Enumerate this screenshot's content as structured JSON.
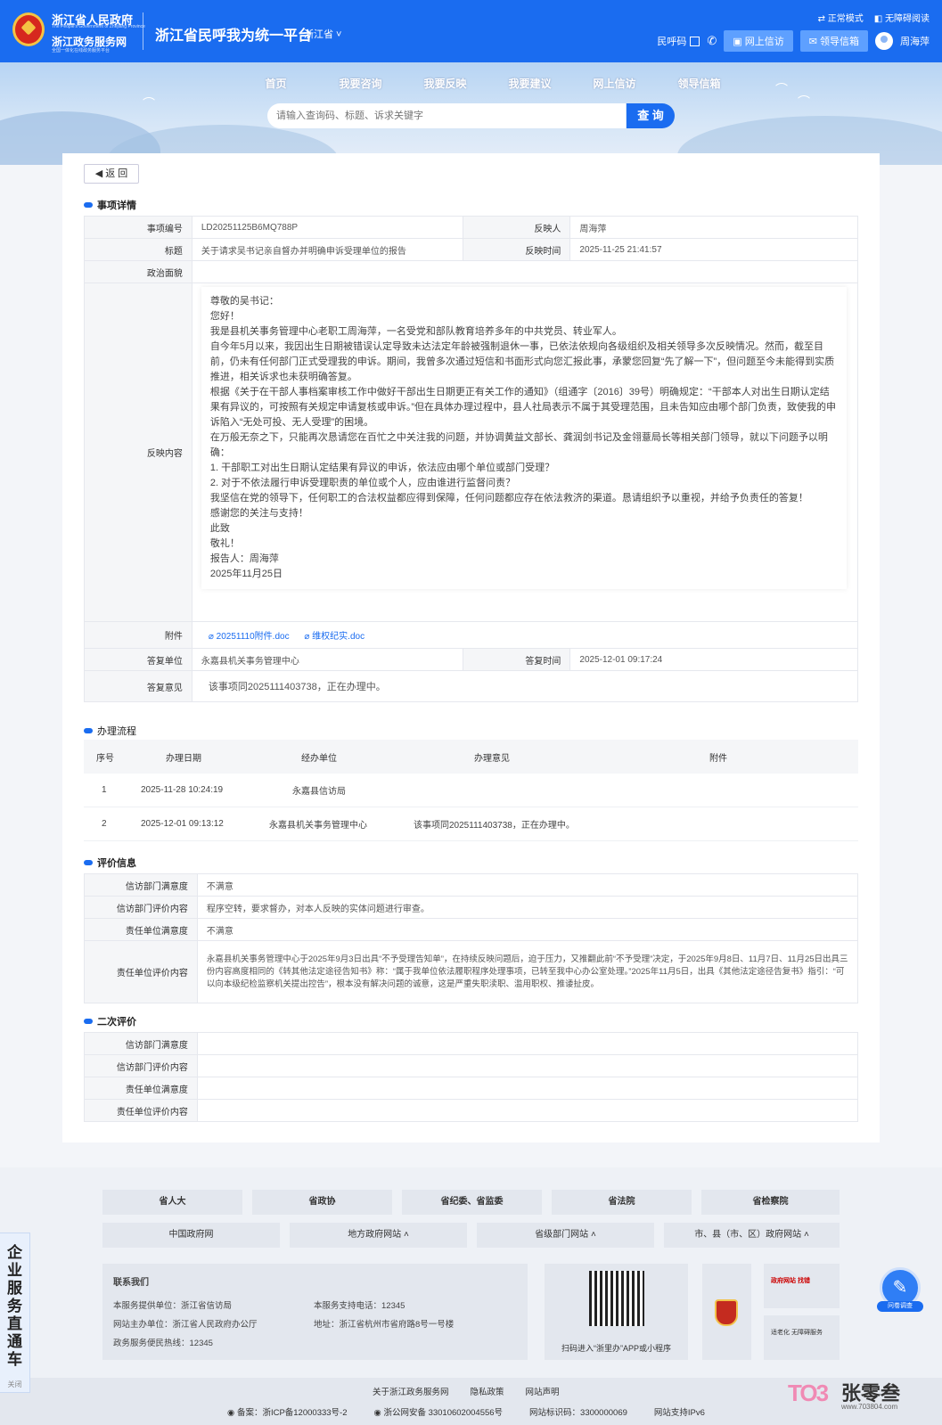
{
  "header": {
    "gov_name": "浙江省人民政府",
    "gov_name_en": "The People's Government of Zhejiang Province",
    "service_name": "浙江政务服务网",
    "service_sub": "全国一体化在线政务服务平台",
    "platform_title": "浙江省民呼我为统一平台",
    "region": "浙江省",
    "mode_normal": "正常模式",
    "mode_accessible": "无障碍阅读",
    "minhu_code": "民呼码",
    "online_petition": "网上信访",
    "leader_mailbox": "领导信箱",
    "user_name": "周海萍"
  },
  "nav": [
    "首页",
    "我要咨询",
    "我要反映",
    "我要建议",
    "网上信访",
    "领导信箱"
  ],
  "search": {
    "placeholder": "请输入查询码、标题、诉求关键字",
    "button": "查 询"
  },
  "back_label": "返 回",
  "detail": {
    "section_title": "事项详情",
    "id_label": "事项编号",
    "id_value": "LD20251125B6MQ788P",
    "reporter_label": "反映人",
    "reporter_value": "周海萍",
    "title_label": "标题",
    "title_value": "关于请求吴书记亲自督办并明确申诉受理单位的报告",
    "time_label": "反映时间",
    "time_value": "2025-11-25 21:41:57",
    "political_label": "政治面貌",
    "political_value": "",
    "content_label": "反映内容",
    "content_lines": [
      "尊敬的吴书记：",
      "您好！",
      "我是县机关事务管理中心老职工周海萍，一名受党和部队教育培养多年的中共党员、转业军人。",
      "自今年5月以来，我因出生日期被错误认定导致未达法定年龄被强制退休一事，已依法依规向各级组织及相关领导多次反映情况。然而，截至目前，仍未有任何部门正式受理我的申诉。期间，我曾多次通过短信和书面形式向您汇报此事，承蒙您回复“先了解一下”，但问题至今未能得到实质推进，相关诉求也未获明确答复。",
      "根据《关于在干部人事档案审核工作中做好干部出生日期更正有关工作的通知》（组通字〔2016〕39号）明确规定：“干部本人对出生日期认定结果有异议的，可按照有关规定申请复核或申诉。”但在具体办理过程中，县人社局表示不属于其受理范围，且未告知应由哪个部门负责，致使我的申诉陷入“无处可投、无人受理”的困境。",
      "在万般无奈之下，只能再次恳请您在百忙之中关注我的问题，并协调黄益文部长、龚润剑书记及金翎薏局长等相关部门领导，就以下问题予以明确：",
      "1. 干部职工对出生日期认定结果有异议的申诉，依法应由哪个单位或部门受理？",
      "2. 对于不依法履行申诉受理职责的单位或个人，应由谁进行监督问责？",
      "我坚信在党的领导下，任何职工的合法权益都应得到保障，任何问题都应存在依法救济的渠道。恳请组织予以重视，并给予负责任的答复！",
      "感谢您的关注与支持！",
      "此致",
      "敬礼！",
      "报告人：周海萍",
      "2025年11月25日"
    ],
    "attach_label": "附件",
    "attachments": [
      "20251110附件.doc",
      "维权纪实.doc"
    ],
    "reply_unit_label": "答复单位",
    "reply_unit_value": "永嘉县机关事务管理中心",
    "reply_time_label": "答复时间",
    "reply_time_value": "2025-12-01 09:17:24",
    "reply_opinion_label": "答复意见",
    "reply_opinion_value": "该事项同2025111403738，正在办理中。"
  },
  "flow": {
    "section_title": "办理流程",
    "headers": [
      "序号",
      "办理日期",
      "经办单位",
      "办理意见",
      "附件"
    ],
    "rows": [
      {
        "no": "1",
        "date": "2025-11-28 10:24:19",
        "unit": "永嘉县信访局",
        "opinion": "",
        "attach": ""
      },
      {
        "no": "2",
        "date": "2025-12-01 09:13:12",
        "unit": "永嘉县机关事务管理中心",
        "opinion": "该事项同2025111403738，正在办理中。",
        "attach": ""
      }
    ]
  },
  "evaluation": {
    "section_title": "评价信息",
    "dept_sat_label": "信访部门满意度",
    "dept_sat_value": "不满意",
    "dept_eval_label": "信访部门评价内容",
    "dept_eval_value": "程序空转，要求督办，对本人反映的实体问题进行审查。",
    "unit_sat_label": "责任单位满意度",
    "unit_sat_value": "不满意",
    "unit_eval_label": "责任单位评价内容",
    "unit_eval_value": "永嘉县机关事务管理中心于2025年9月3日出具“不予受理告知单”，在持续反映问题后，迫于压力，又推翻此前“不予受理”决定，于2025年9月8日、11月7日、11月25日出具三份内容高度相同的《转其他法定途径告知书》称：“属于我单位依法履职程序处理事项，已转至我中心办公室处理。”2025年11月5日，出具《其他法定途径告复书》指引：“可以向本级纪检监察机关提出控告”，根本没有解决问题的诚意，这是严重失职渎职、滥用职权、推诿扯皮。"
  },
  "second_evaluation": {
    "section_title": "二次评价",
    "dept_sat_label": "信访部门满意度",
    "dept_sat_value": "",
    "dept_eval_label": "信访部门评价内容",
    "dept_eval_value": "",
    "unit_sat_label": "责任单位满意度",
    "unit_sat_value": "",
    "unit_eval_label": "责任单位评价内容",
    "unit_eval_value": ""
  },
  "footer": {
    "row1": [
      "省人大",
      "省政协",
      "省纪委、省监委",
      "省法院",
      "省检察院"
    ],
    "row2": [
      "中国政府网",
      "地方政府网站",
      "省级部门网站",
      "市、县（市、区）政府网站"
    ],
    "contact_title": "联系我们",
    "provider": "本服务提供单位：浙江省信访局",
    "phone": "本服务支持电话：12345",
    "host": "网站主办单位：浙江省人民政府办公厅",
    "address": "地址：浙江省杭州市省府路8号一号楼",
    "hotline": "政务服务便民热线：12345",
    "qr_caption": "扫码进入“浙里办”APP或小程序",
    "badge1": "政府网站 找错",
    "badge2": "适老化 无障碍服务",
    "links": [
      "关于浙江政务服务网",
      "隐私政策",
      "网站声明"
    ],
    "icp": "备案：浙ICP备12000333号-2",
    "police": "浙公网安备 33010602004556号",
    "site_id": "网站标识码：3300000069",
    "ipv6": "网站支持IPv6"
  },
  "side_tab": {
    "text": "企业服务直通车",
    "close": "关闭"
  },
  "survey_label": "问卷调查",
  "brand": {
    "name": "张零叁",
    "url": "www.703804.com"
  }
}
